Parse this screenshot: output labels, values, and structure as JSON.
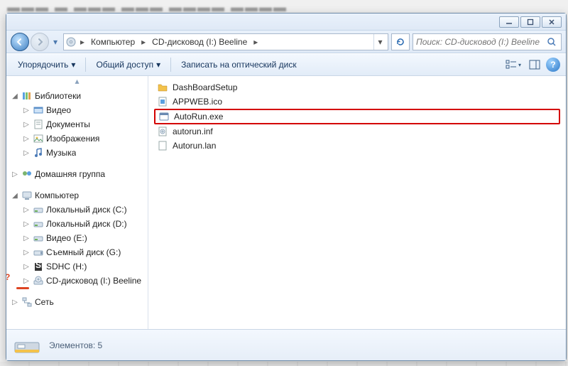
{
  "titlebar": {
    "min": "min",
    "max": "max",
    "close": "close"
  },
  "address": {
    "segments": [
      "Компьютер",
      "CD-дисковод (I:) Beeline"
    ],
    "search_placeholder": "Поиск: CD-дисковод (I:) Beeline"
  },
  "toolbar": {
    "organize": "Упорядочить",
    "share": "Общий доступ",
    "burn": "Записать на оптический диск"
  },
  "tree": {
    "libraries": {
      "label": "Библиотеки",
      "children": [
        {
          "label": "Видео",
          "icon": "video"
        },
        {
          "label": "Документы",
          "icon": "doc"
        },
        {
          "label": "Изображения",
          "icon": "image"
        },
        {
          "label": "Музыка",
          "icon": "music"
        }
      ]
    },
    "homegroup": {
      "label": "Домашняя группа"
    },
    "computer": {
      "label": "Компьютер",
      "children": [
        {
          "label": "Локальный диск (C:)",
          "icon": "drive"
        },
        {
          "label": "Локальный диск (D:)",
          "icon": "drive"
        },
        {
          "label": "Видео (E:)",
          "icon": "drive"
        },
        {
          "label": "Съемный диск (G:)",
          "icon": "usb"
        },
        {
          "label": "SDHC (H:)",
          "icon": "sd"
        },
        {
          "label": "CD-дисковод (I:) Beeline",
          "icon": "cd"
        }
      ]
    },
    "network": {
      "label": "Сеть"
    }
  },
  "files": [
    {
      "name": "DashBoardSetup",
      "icon": "folder",
      "hl": false
    },
    {
      "name": "APPWEB.ico",
      "icon": "ico",
      "hl": false
    },
    {
      "name": "AutoRun.exe",
      "icon": "exe",
      "hl": true
    },
    {
      "name": "autorun.inf",
      "icon": "inf",
      "hl": false
    },
    {
      "name": "Autorun.lan",
      "icon": "file",
      "hl": false
    }
  ],
  "status": {
    "label": "Элементов:",
    "count": "5"
  },
  "colors": {
    "accent": "#3d7dc0",
    "highlight_border": "#d40000"
  }
}
